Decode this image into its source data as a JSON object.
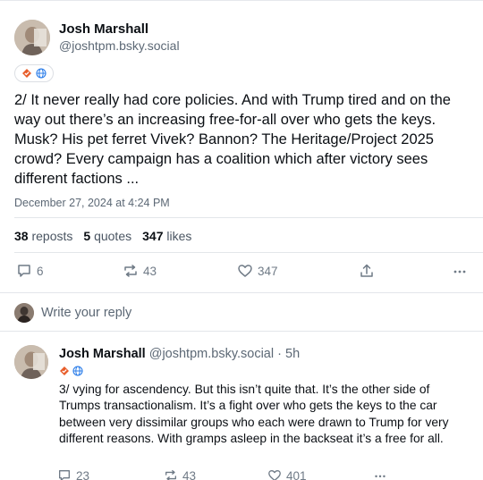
{
  "main_post": {
    "author_name": "Josh Marshall",
    "author_handle": "@joshtpm.bsky.social",
    "badges": [
      "verified-badge-icon",
      "globe-icon"
    ],
    "text": "2/ It never really had core policies. And with Trump tired and on the way out there’s an increasing free-for-all over who gets the keys. Musk? His pet ferret Vivek? Bannon? The Heritage/Project 2025 crowd? Every campaign has a coalition which after victory sees different factions ...",
    "date": "December 27, 2024 at 4:24 PM",
    "stats": {
      "reposts_count": "38",
      "reposts_label": "reposts",
      "quotes_count": "5",
      "quotes_label": "quotes",
      "likes_count": "347",
      "likes_label": "likes"
    },
    "actions": {
      "replies": "6",
      "reposts": "43",
      "likes": "347"
    }
  },
  "reply_box": {
    "placeholder": "Write your reply"
  },
  "reply_post": {
    "author_name": "Josh Marshall",
    "author_handle": "@joshtpm.bsky.social",
    "separator": "·",
    "time": "5h",
    "text": "3/ vying for ascendency. But this isn’t quite that. It’s the other side of Trumps transactionalism. It’s a fight over who gets the keys to the car between very dissimilar groups who each were drawn to Trump for very different reasons. With gramps asleep in the backseat it’s a free for all.",
    "actions": {
      "replies": "23",
      "reposts": "43",
      "likes": "401"
    }
  },
  "colors": {
    "text": "#0b0f14",
    "muted": "#5c6875",
    "icon": "#6f7a86",
    "divider": "#e3e6ea",
    "badge_orange": "#e85d2a",
    "badge_blue": "#2b7de9"
  }
}
